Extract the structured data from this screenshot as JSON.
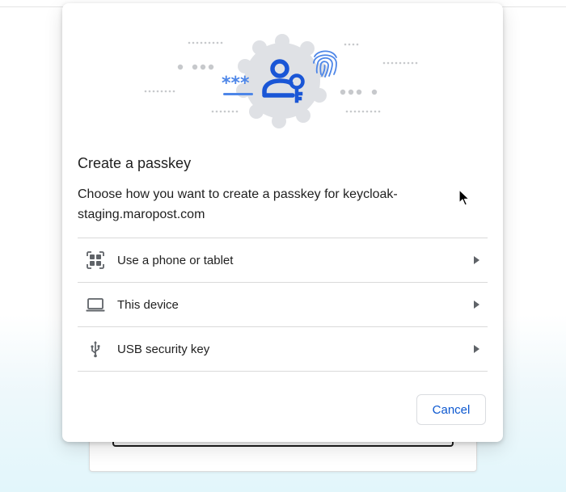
{
  "dialog": {
    "title": "Create a passkey",
    "subtitle": "Choose how you want to create a passkey for keycloak-staging.maropost.com",
    "options": [
      {
        "label": "Use a phone or tablet",
        "icon": "qr-code-icon"
      },
      {
        "label": "This device",
        "icon": "laptop-icon"
      },
      {
        "label": "USB security key",
        "icon": "usb-icon"
      }
    ],
    "cancel_label": "Cancel",
    "illustration": {
      "password_mask": "***",
      "icons": [
        "passkey-user-icon",
        "key-icon",
        "fingerprint-icon"
      ]
    }
  },
  "colors": {
    "accent": "#0b57d0",
    "illustration_blue": "#1a56d6",
    "illustration_badge": "#dfe1e5",
    "divider": "#dadada"
  }
}
